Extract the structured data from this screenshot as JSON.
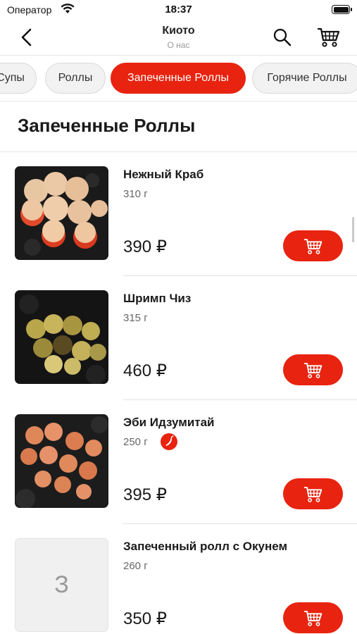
{
  "status_bar": {
    "carrier": "Оператор",
    "time": "18:37"
  },
  "nav": {
    "title": "Киото",
    "subtitle": "О нас"
  },
  "tabs": [
    {
      "label": "Супы",
      "active": false
    },
    {
      "label": "Роллы",
      "active": false
    },
    {
      "label": "Запеченные Роллы",
      "active": true
    },
    {
      "label": "Горячие Роллы",
      "active": false
    }
  ],
  "section": {
    "title": "Запеченные Роллы"
  },
  "items": [
    {
      "name": "Нежный Краб",
      "weight": "310 г",
      "price": "390 ₽",
      "spicy": false
    },
    {
      "name": "Шримп Чиз",
      "weight": "315 г",
      "price": "460 ₽",
      "spicy": false
    },
    {
      "name": "Эби Идзумитай",
      "weight": "250 г",
      "price": "395 ₽",
      "spicy": true
    },
    {
      "name": "Запеченный ролл с Окунем",
      "weight": "260 г",
      "price": "350 ₽",
      "spicy": false,
      "placeholder": "З"
    }
  ],
  "colors": {
    "accent": "#e8230f",
    "tab_inactive_bg": "#f2f2f2",
    "text_primary": "#1a1a1a",
    "text_secondary": "#666666"
  },
  "icons": {
    "back": "chevron-left-icon",
    "search": "search-icon",
    "cart": "cart-icon",
    "spicy": "chili-pepper-icon"
  }
}
